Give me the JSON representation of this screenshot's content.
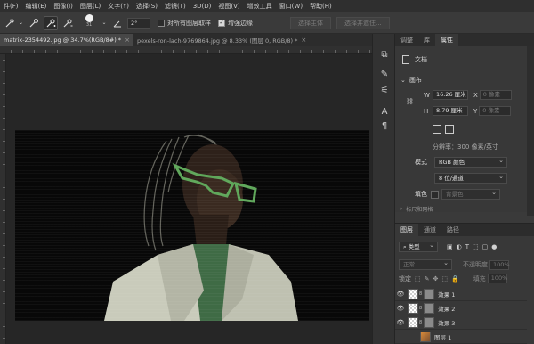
{
  "menu": [
    "件(F)",
    "编辑(E)",
    "图像(I)",
    "图层(L)",
    "文字(Y)",
    "选择(S)",
    "滤镜(T)",
    "3D(D)",
    "视图(V)",
    "增效工具",
    "窗口(W)",
    "帮助(H)"
  ],
  "options": {
    "brush_size": "31",
    "angle_value": "2°",
    "sample_all_label": "对所有图层取样",
    "enhance_edge_label": "增强边缘",
    "select_subject_label": "选择主体",
    "select_mask_label": "选择并遮住..."
  },
  "tabs": [
    {
      "label": "matrix-2354492.jpg @ 34.7%(RGB/8#) *",
      "close": "×"
    },
    {
      "label": "pexels-ron-lach-9769864.jpg @ 8.33% (图层 0, RGB/8) *",
      "close": "×"
    }
  ],
  "properties": {
    "tabs": [
      "调整",
      "库",
      "属性"
    ],
    "doc_label": "文档",
    "canvas_label": "画布",
    "w_label": "W",
    "w_value": "16.26 厘米",
    "x_label": "X",
    "x_value": "0 像素",
    "h_label": "H",
    "h_value": "8.79 厘米",
    "y_label": "Y",
    "y_value": "0 像素",
    "resolution": "分辨率：300 像素/英寸",
    "mode_label": "模式",
    "mode_value": "RGB 颜色",
    "depth_value": "8 位/通道",
    "fill_label": "填色",
    "fill_value": "背景色",
    "section_cut": "标尺和网格"
  },
  "layers": {
    "tabs": [
      "图层",
      "通道",
      "路径"
    ],
    "filter_label": "类型",
    "blend_mode": "正常",
    "opacity_label": "不透明度",
    "opacity_value": "100%",
    "lock_label": "锁定",
    "fill_label": "填充",
    "fill_value": "100%",
    "items": [
      {
        "name": "效果 1",
        "visible_icon": "👁"
      },
      {
        "name": "效果 2",
        "visible_icon": "👁"
      },
      {
        "name": "效果 3",
        "visible_icon": "👁"
      },
      {
        "name": "图层 1",
        "visible_icon": ""
      }
    ]
  },
  "icons": {
    "brush": "brush-icon",
    "visibility": "eye-icon",
    "layer_filter": "filter-icon"
  },
  "colors": {
    "canvas_bg": "#080808",
    "skin": "#3a2a20",
    "jacket": "#c9cbbb",
    "glasses": "#5fa75a"
  }
}
